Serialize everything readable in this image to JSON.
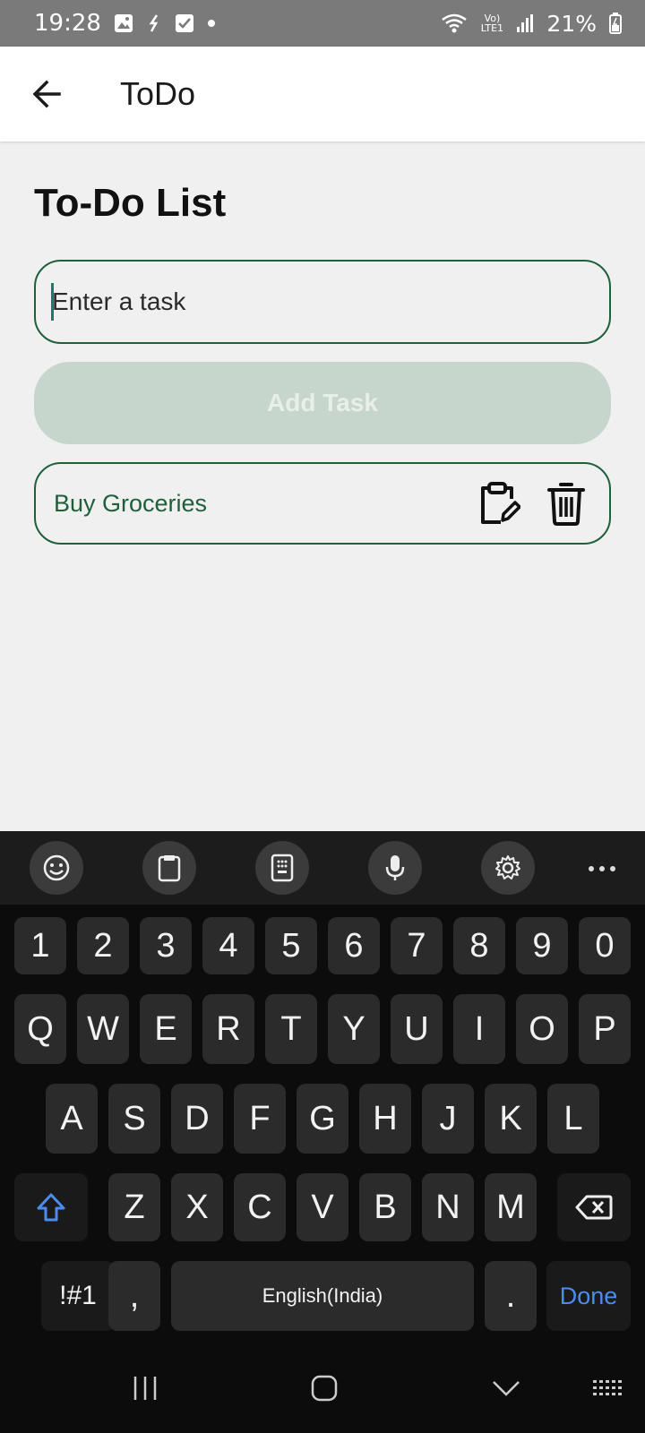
{
  "status_bar": {
    "time": "19:28",
    "battery_text": "21%",
    "network_label": "Vo) LTE1"
  },
  "app_bar": {
    "title": "ToDo"
  },
  "main": {
    "heading": "To-Do List",
    "task_input": {
      "value": "",
      "placeholder": "Enter a task"
    },
    "add_button_label": "Add Task",
    "tasks": [
      {
        "text": "Buy Groceries"
      }
    ]
  },
  "keyboard": {
    "number_row": [
      "1",
      "2",
      "3",
      "4",
      "5",
      "6",
      "7",
      "8",
      "9",
      "0"
    ],
    "row1": [
      "Q",
      "W",
      "E",
      "R",
      "T",
      "Y",
      "U",
      "I",
      "O",
      "P"
    ],
    "row2": [
      "A",
      "S",
      "D",
      "F",
      "G",
      "H",
      "J",
      "K",
      "L"
    ],
    "row3": [
      "Z",
      "X",
      "C",
      "V",
      "B",
      "N",
      "M"
    ],
    "symbols_label": "!#1",
    "comma": ",",
    "space_label": "English(India)",
    "period": ".",
    "done_label": "Done"
  },
  "colors": {
    "accent": "#1e5f3c",
    "add_button_bg": "#c6d6cc",
    "done_key": "#4a8cf0"
  }
}
